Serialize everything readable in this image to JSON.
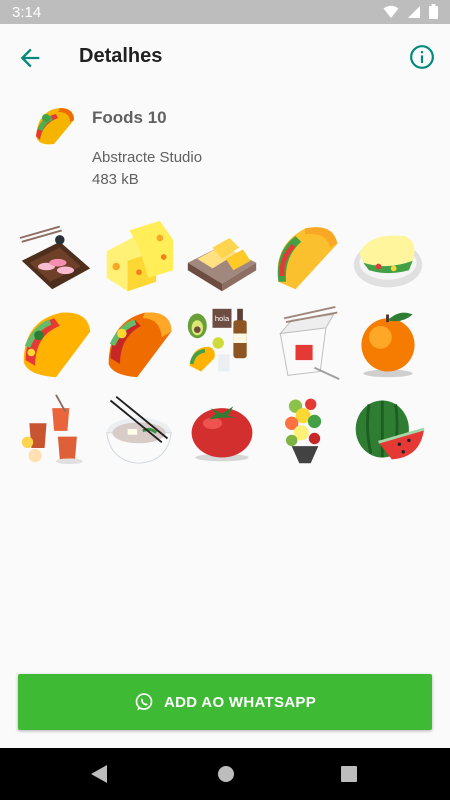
{
  "status_bar": {
    "time": "3:14",
    "icons": [
      "wifi-icon",
      "signal-icon",
      "battery-icon"
    ]
  },
  "app_bar": {
    "title": "Detalhes",
    "back_icon": "arrow-back-icon",
    "info_icon": "info-icon"
  },
  "pack": {
    "name": "Foods 10",
    "publisher": "Abstracte Studio",
    "size": "483 kB",
    "tray_icon": "taco-sticker"
  },
  "stickers": [
    "sushi-board",
    "cheese-pieces",
    "cheese-box",
    "taco",
    "burrito-plate",
    "taco-large",
    "taco-decorated",
    "mexican-food-collage",
    "chinese-takeout-box",
    "orange",
    "tea-glasses",
    "soup-bowl",
    "tomato",
    "food-bouquet",
    "watermelon"
  ],
  "add_button": {
    "label": "ADD AO WHATSAPP",
    "icon": "whatsapp-icon"
  },
  "colors": {
    "accent": "#00897b",
    "button": "#3fba35",
    "status_bar": "#bdbdbd"
  },
  "nav_bar": {
    "icons": [
      "nav-back-icon",
      "nav-home-icon",
      "nav-recents-icon"
    ]
  }
}
